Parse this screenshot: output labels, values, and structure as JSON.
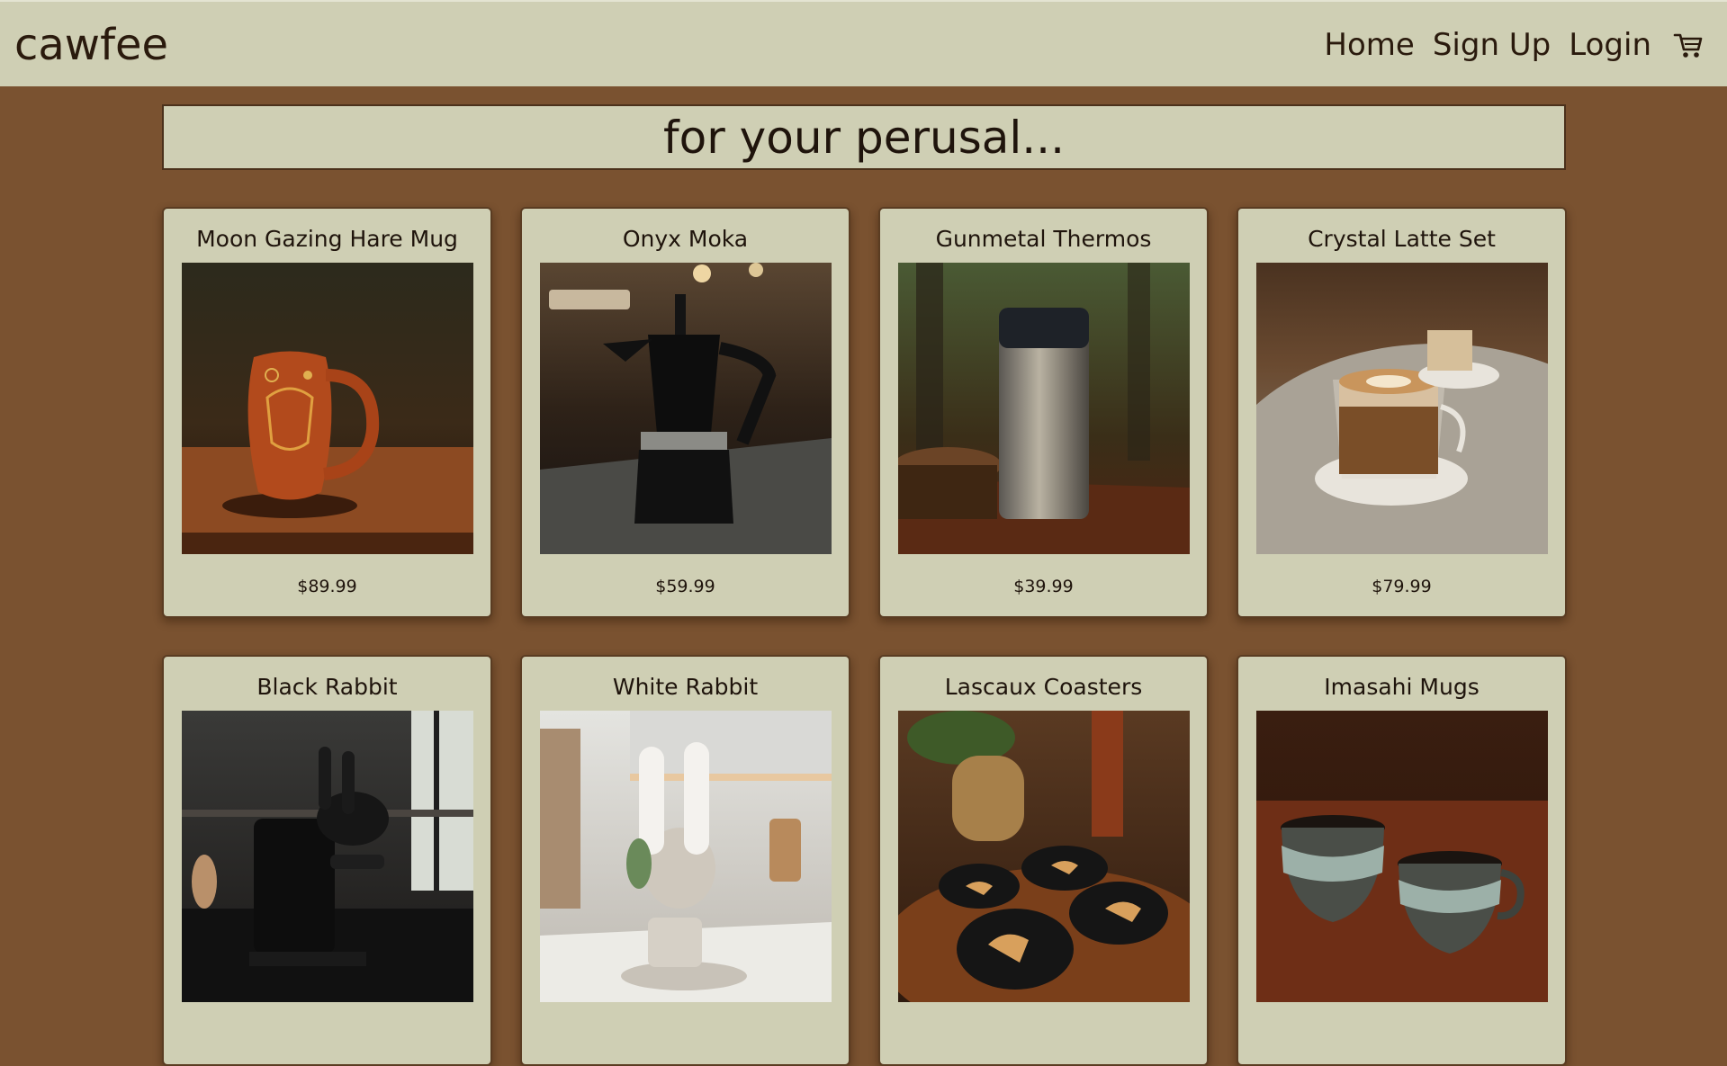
{
  "navbar": {
    "brand": "cawfee",
    "links": [
      "Home",
      "Sign Up",
      "Login"
    ],
    "cart_icon": "cart-icon"
  },
  "banner": {
    "text": "for your perusal..."
  },
  "products": [
    {
      "name": "Moon Gazing Hare Mug",
      "price": "$89.99"
    },
    {
      "name": "Onyx Moka",
      "price": "$59.99"
    },
    {
      "name": "Gunmetal Thermos",
      "price": "$39.99"
    },
    {
      "name": "Crystal Latte Set",
      "price": "$79.99"
    },
    {
      "name": "Black Rabbit",
      "price": ""
    },
    {
      "name": "White Rabbit",
      "price": ""
    },
    {
      "name": "Lascaux Coasters",
      "price": ""
    },
    {
      "name": "Imasahi Mugs",
      "price": ""
    }
  ],
  "colors": {
    "page_background": "#7a5230",
    "panel_background": "#cfcfb4",
    "text": "#1f140c",
    "border": "#5a3c22"
  }
}
